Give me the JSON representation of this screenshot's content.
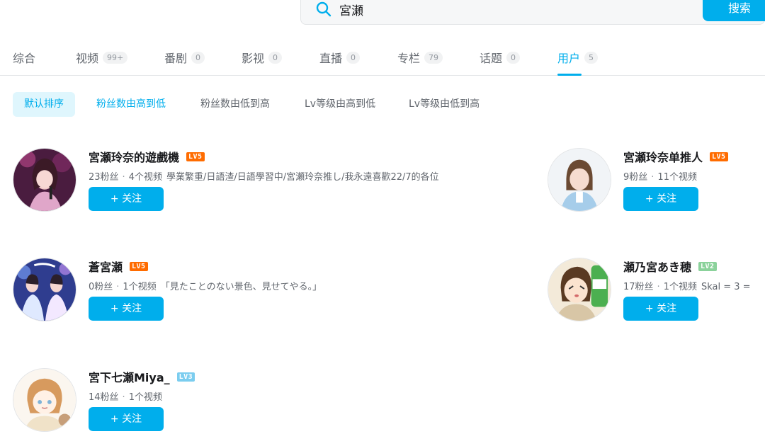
{
  "search": {
    "query": "宮瀬",
    "button_label": "搜索"
  },
  "tabs": [
    {
      "label": "综合",
      "count": ""
    },
    {
      "label": "视频",
      "count": "99+"
    },
    {
      "label": "番剧",
      "count": "0"
    },
    {
      "label": "影视",
      "count": "0"
    },
    {
      "label": "直播",
      "count": "0"
    },
    {
      "label": "专栏",
      "count": "79"
    },
    {
      "label": "话题",
      "count": "0"
    },
    {
      "label": "用户",
      "count": "5"
    }
  ],
  "active_tab": "用户",
  "sort": [
    {
      "label": "默认排序"
    },
    {
      "label": "粉丝数由高到低"
    },
    {
      "label": "粉丝数由低到高"
    },
    {
      "label": "Lv等级由高到低"
    },
    {
      "label": "Lv等级由低到高"
    }
  ],
  "users": [
    {
      "name": "宮瀬玲奈的遊戲機",
      "level": "LV5",
      "level_color": "#ff6c00",
      "fans": "23粉丝",
      "videos": "4个视频",
      "sign": "學業繁重/日語渣/日語學習中/宮瀬玲奈推し/我永遠喜歡22/7的各位",
      "follow_label": "+ 关注"
    },
    {
      "name": "宮瀬玲奈单推人",
      "level": "LV5",
      "level_color": "#ff6c00",
      "fans": "9粉丝",
      "videos": "11个视频",
      "sign": "",
      "follow_label": "+ 关注"
    },
    {
      "name": "蒼宮瀬",
      "level": "LV5",
      "level_color": "#ff6c00",
      "fans": "0粉丝",
      "videos": "1个视频",
      "sign": "「見たことのない景色、見せてやる。」",
      "follow_label": "+ 关注"
    },
    {
      "name": "瀬乃宮あき穂",
      "level": "LV2",
      "level_color": "#8bd29b",
      "fans": "17粉丝",
      "videos": "1个视频",
      "sign": "Skal = 3 =",
      "follow_label": "+ 关注"
    },
    {
      "name": "宮下七瀬Miya_",
      "level": "LV3",
      "level_color": "#7bcdef",
      "fans": "14粉丝",
      "videos": "1个视频",
      "sign": "",
      "follow_label": "+ 关注"
    }
  ]
}
